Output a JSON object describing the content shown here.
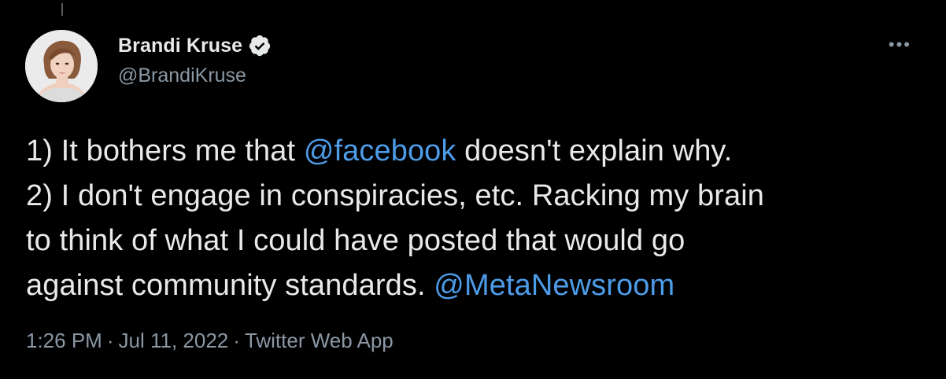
{
  "author": {
    "display_name": "Brandi Kruse",
    "handle": "@BrandiKruse",
    "verified": true
  },
  "more_icon": "more-dots-icon",
  "tweet": {
    "line1_pre": "1) It bothers me that ",
    "mention_facebook": "@facebook",
    "line1_post": " doesn't explain why.",
    "line2": "2) I don't engage in conspiracies, etc. Racking my brain",
    "line3": "to think of what I could have posted that would go",
    "line4_pre": "against community standards. ",
    "mention_meta": "@MetaNewsroom"
  },
  "meta": {
    "time": "1:26 PM",
    "separator": "·",
    "date": "Jul 11, 2022",
    "source": "Twitter Web App"
  },
  "colors": {
    "background": "#000000",
    "text": "#e7e9ea",
    "secondary": "#8b98a5",
    "link": "#4d9ce8"
  }
}
